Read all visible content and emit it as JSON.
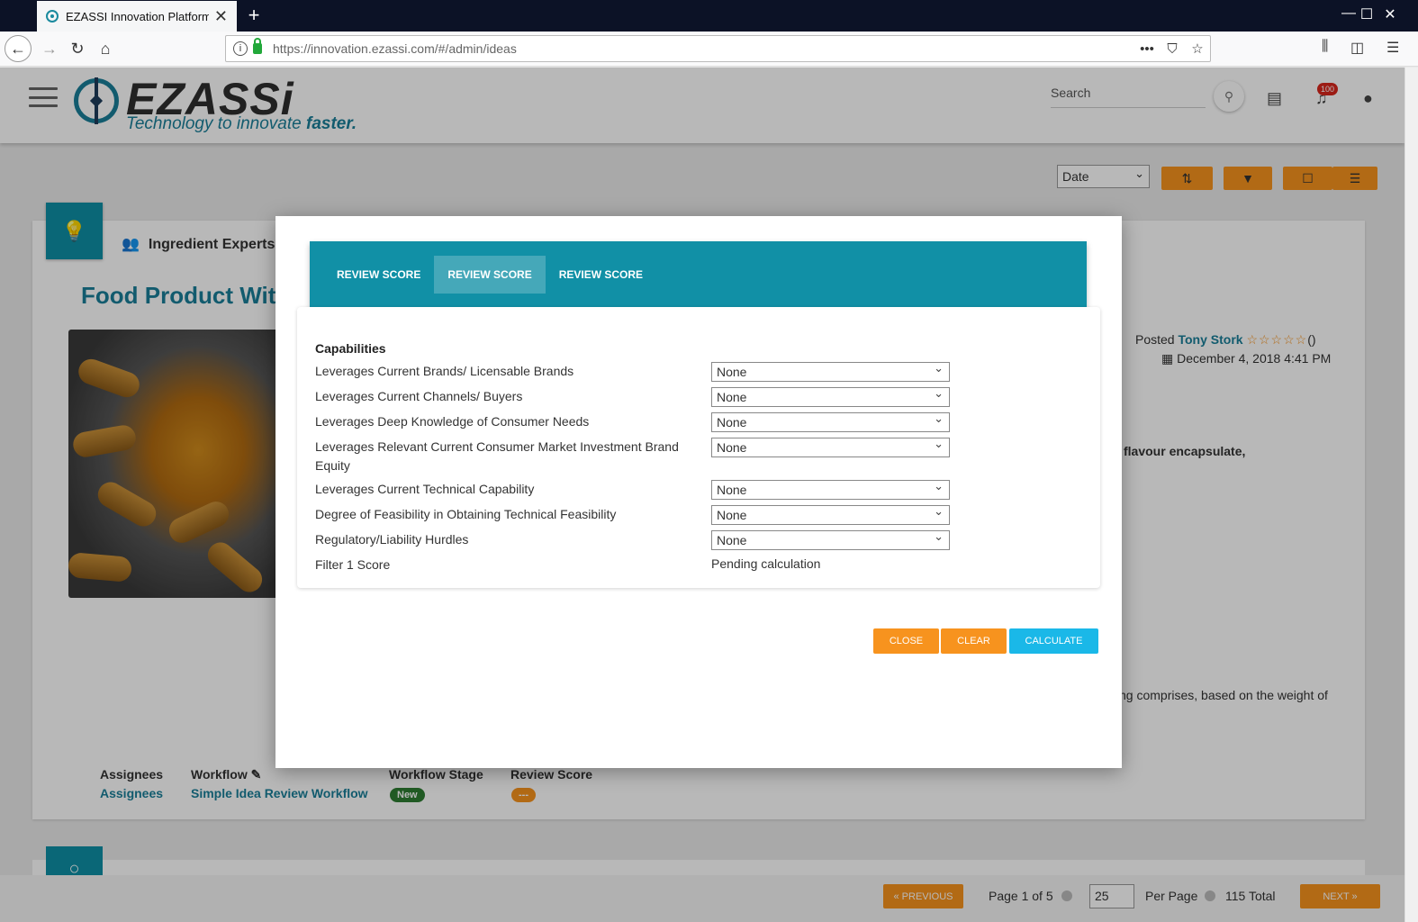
{
  "browser": {
    "tab_title": "EZASSI Innovation Platform",
    "tab_close": "✕",
    "new_tab": "+",
    "url": "https://innovation.ezassi.com/#/admin/ideas",
    "url_more": "•••",
    "win_min": "—",
    "win_max": "☐",
    "win_close": "✕"
  },
  "header": {
    "logo_text": "EZASSi",
    "tagline_prefix": "Technology to innovate ",
    "tagline_emph": "faster.",
    "search_placeholder": "Search",
    "notification_count": "100"
  },
  "toolbar": {
    "sort_select": "Date"
  },
  "idea": {
    "group": "Ingredient Experts",
    "title": "Food Product With",
    "posted_prefix": "Posted ",
    "author": "Tony Stork",
    "rating_stars": "☆☆☆☆☆",
    "rating_count": "()",
    "date": "December 4, 2018 4:41 PM",
    "body_fragment_1": "flavour encapsulate,",
    "body_fragment_2": "ng comprises, based on the weight of",
    "assignees_label": "Assignees",
    "assignees_value": "Assignees",
    "workflow_label": "Workflow",
    "workflow_value": "Simple Idea Review Workflow",
    "workflow_stage_label": "Workflow Stage",
    "workflow_stage_value": "New",
    "review_score_label": "Review Score",
    "review_score_value": "---"
  },
  "pagination": {
    "prev": "« PREVIOUS",
    "page_text": "Page 1 of 5",
    "per_page_value": "25",
    "per_page_label": "Per Page",
    "total": "115 Total",
    "next": "NEXT »"
  },
  "modal": {
    "tabs": [
      "REVIEW SCORE",
      "REVIEW SCORE",
      "REVIEW SCORE"
    ],
    "section_title": "Capabilities",
    "criteria": [
      {
        "label": "Leverages Current Brands/ Licensable Brands",
        "value": "None"
      },
      {
        "label": "Leverages Current Channels/ Buyers",
        "value": "None"
      },
      {
        "label": "Leverages Deep Knowledge of Consumer Needs",
        "value": "None"
      },
      {
        "label": "Leverages Relevant Current Consumer Market Investment Brand Equity",
        "value": "None"
      },
      {
        "label": "Leverages Current Technical Capability",
        "value": "None"
      },
      {
        "label": "Degree of Feasibility in Obtaining Technical Feasibility",
        "value": "None"
      },
      {
        "label": "Regulatory/Liability Hurdles",
        "value": "None"
      }
    ],
    "score_label": "Filter 1 Score",
    "score_value": "Pending calculation",
    "buttons": {
      "close": "CLOSE",
      "clear": "CLEAR",
      "calculate": "CALCULATE"
    }
  },
  "colors": {
    "accent_teal": "#1190a6",
    "accent_orange": "#f7931e",
    "calculate_blue": "#1ab8e8",
    "stage_green": "#2e7d32"
  }
}
